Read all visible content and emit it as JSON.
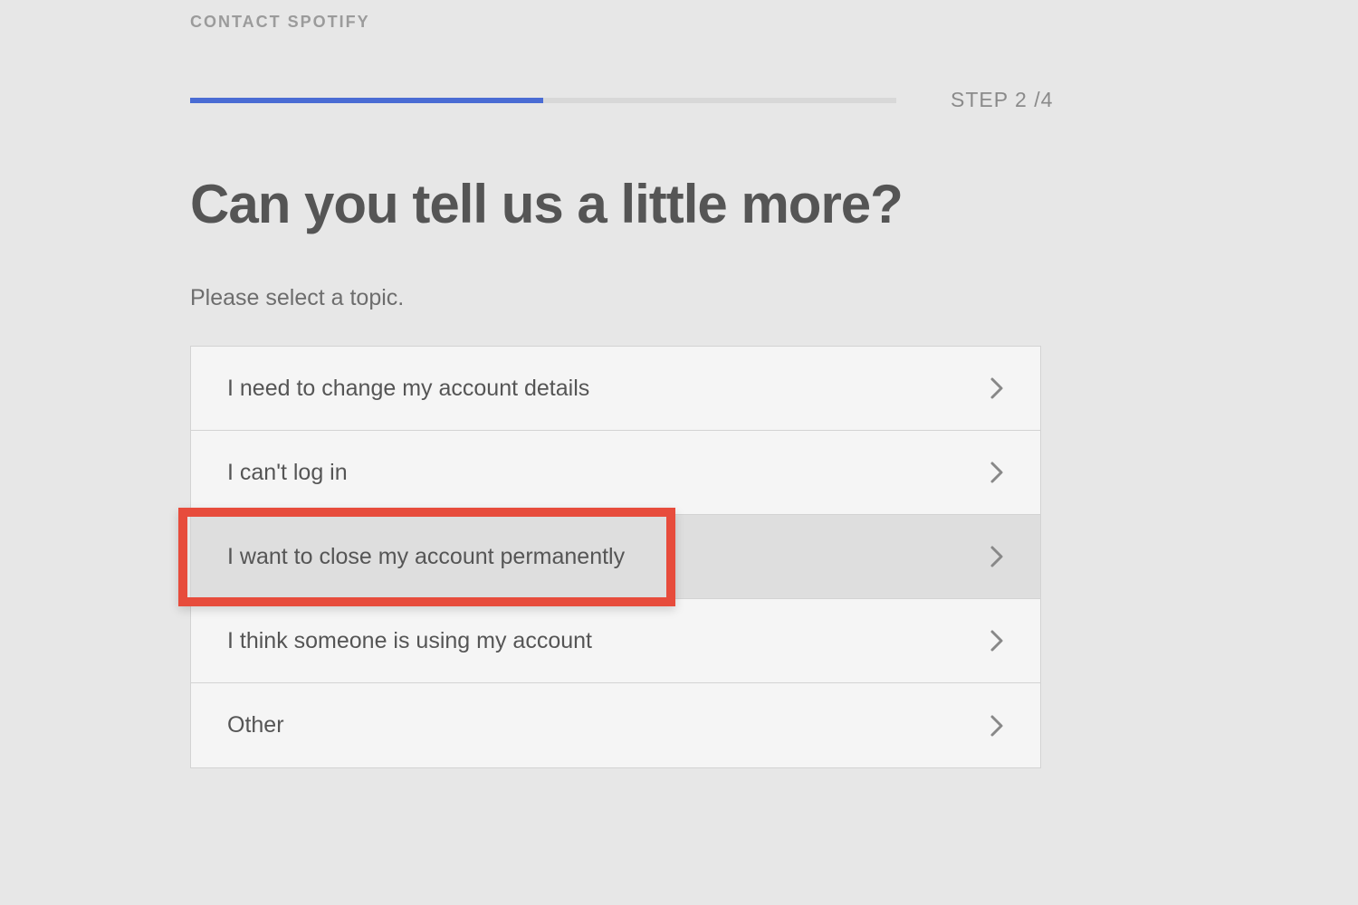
{
  "breadcrumb": "CONTACT SPOTIFY",
  "progress": {
    "step_label": "STEP 2 /4",
    "fill_percent": 50
  },
  "heading": "Can you tell us a little more?",
  "subheading": "Please select a topic.",
  "topics": [
    {
      "label": "I need to change my account details",
      "hovered": false,
      "highlighted": false
    },
    {
      "label": "I can't log in",
      "hovered": false,
      "highlighted": false
    },
    {
      "label": "I want to close my account permanently",
      "hovered": true,
      "highlighted": true
    },
    {
      "label": "I think someone is using my account",
      "hovered": false,
      "highlighted": false
    },
    {
      "label": "Other",
      "hovered": false,
      "highlighted": false
    }
  ],
  "colors": {
    "background": "#e7e7e7",
    "progress_fill": "#4a6cd4",
    "highlight_border": "#e74c3c"
  }
}
